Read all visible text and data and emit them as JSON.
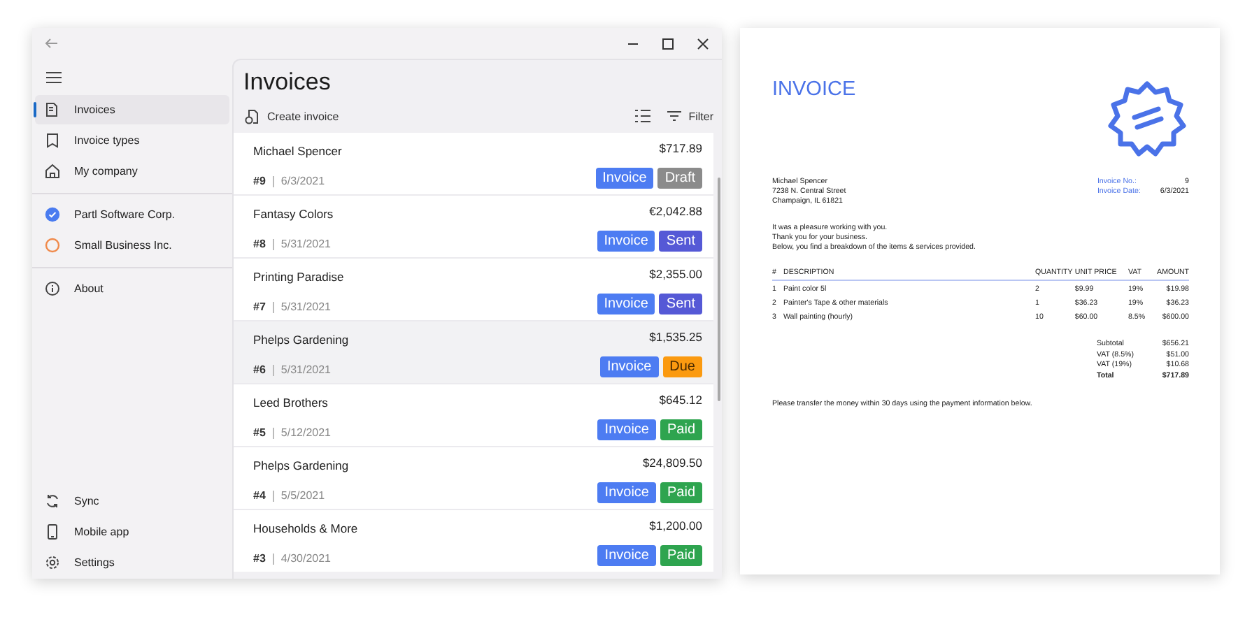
{
  "sidebar": {
    "nav": [
      {
        "label": "Invoices",
        "selected": true
      },
      {
        "label": "Invoice types",
        "selected": false
      },
      {
        "label": "My company",
        "selected": false
      }
    ],
    "companies": [
      {
        "label": "Partl Software Corp.",
        "checked": true,
        "color": "#4a7cf0"
      },
      {
        "label": "Small Business Inc.",
        "checked": false,
        "color": "#f08a4b"
      }
    ],
    "about": {
      "label": "About"
    },
    "bottom": [
      {
        "label": "Sync"
      },
      {
        "label": "Mobile app"
      },
      {
        "label": "Settings"
      }
    ]
  },
  "main": {
    "title": "Invoices",
    "create_button": "Create invoice",
    "filter_button": "Filter",
    "rows": [
      {
        "name": "Michael Spencer",
        "number": "#9",
        "date": "6/3/2021",
        "amount": "$717.89",
        "type": "Invoice",
        "status": "Draft",
        "kind": "draft",
        "selected": false
      },
      {
        "name": "Fantasy Colors",
        "number": "#8",
        "date": "5/31/2021",
        "amount": "€2,042.88",
        "type": "Invoice",
        "status": "Sent",
        "kind": "sent",
        "selected": false
      },
      {
        "name": "Printing Paradise",
        "number": "#7",
        "date": "5/31/2021",
        "amount": "$2,355.00",
        "type": "Invoice",
        "status": "Sent",
        "kind": "sent",
        "selected": false
      },
      {
        "name": "Phelps Gardening",
        "number": "#6",
        "date": "5/31/2021",
        "amount": "$1,535.25",
        "type": "Invoice",
        "status": "Due",
        "kind": "due",
        "selected": true
      },
      {
        "name": "Leed Brothers",
        "number": "#5",
        "date": "5/12/2021",
        "amount": "$645.12",
        "type": "Invoice",
        "status": "Paid",
        "kind": "paid",
        "selected": false
      },
      {
        "name": "Phelps Gardening",
        "number": "#4",
        "date": "5/5/2021",
        "amount": "$24,809.50",
        "type": "Invoice",
        "status": "Paid",
        "kind": "paid",
        "selected": false
      },
      {
        "name": "Households & More",
        "number": "#3",
        "date": "4/30/2021",
        "amount": "$1,200.00",
        "type": "Invoice",
        "status": "Paid",
        "kind": "paid",
        "selected": false
      }
    ]
  },
  "document": {
    "title": "INVOICE",
    "address": [
      "Michael Spencer",
      "7238 N. Central Street",
      "Champaign, IL 61821"
    ],
    "meta": [
      {
        "label": "Invoice No.:",
        "value": "9"
      },
      {
        "label": "Invoice Date:",
        "value": "6/3/2021"
      }
    ],
    "greeting": [
      "It was a pleasure working with you.",
      "Thank you for your business.",
      "Below, you find a breakdown of the items & services provided."
    ],
    "columns": [
      "#",
      "DESCRIPTION",
      "QUANTITY",
      "UNIT PRICE",
      "VAT",
      "AMOUNT"
    ],
    "items": [
      [
        "1",
        "Paint color 5l",
        "2",
        "$9.99",
        "19%",
        "$19.98"
      ],
      [
        "2",
        "Painter's Tape & other materials",
        "1",
        "$36.23",
        "19%",
        "$36.23"
      ],
      [
        "3",
        "Wall painting (hourly)",
        "10",
        "$60.00",
        "8.5%",
        "$600.00"
      ]
    ],
    "totals": [
      {
        "label": "Subtotal",
        "value": "$656.21",
        "bold": false
      },
      {
        "label": "VAT (8.5%)",
        "value": "$51.00",
        "bold": false
      },
      {
        "label": "VAT (19%)",
        "value": "$10.68",
        "bold": false
      },
      {
        "label": "Total",
        "value": "$717.89",
        "bold": true
      }
    ],
    "footer": "Please transfer the money within 30 days using the payment information below."
  }
}
